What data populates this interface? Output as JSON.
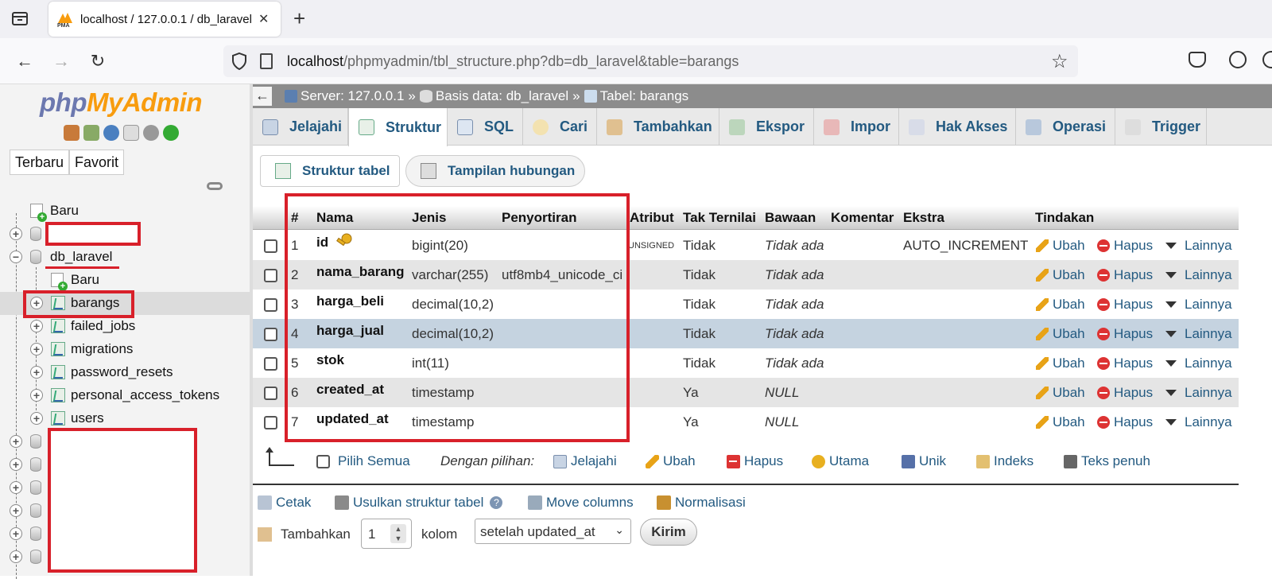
{
  "browser": {
    "tab_title": "localhost / 127.0.0.1 / db_laravel",
    "tab_close": "✕",
    "new_tab": "+",
    "url_host": "localhost",
    "url_path": "/phpmyadmin/tbl_structure.php?db=db_laravel&table=barangs"
  },
  "sidebar": {
    "logo_php": "php",
    "logo_myadmin": "MyAdmin",
    "btn_recent": "Terbaru",
    "btn_favorite": "Favorit",
    "tree": {
      "new_root": "Baru",
      "db_name": "db_laravel",
      "new_table": "Baru",
      "tables": [
        "barangs",
        "failed_jobs",
        "migrations",
        "password_resets",
        "personal_access_tokens",
        "users"
      ]
    }
  },
  "breadcrumb": {
    "server": "Server: 127.0.0.1",
    "database": "Basis data: db_laravel",
    "table": "Tabel: barangs",
    "separator": "»"
  },
  "tabs": [
    "Jelajahi",
    "Struktur",
    "SQL",
    "Cari",
    "Tambahkan",
    "Ekspor",
    "Impor",
    "Hak Akses",
    "Operasi",
    "Trigger"
  ],
  "subtabs": [
    "Struktur tabel",
    "Tampilan hubungan"
  ],
  "columns_header": [
    "#",
    "Nama",
    "Jenis",
    "Penyortiran",
    "Atribut",
    "Tak Ternilai",
    "Bawaan",
    "Komentar",
    "Ekstra",
    "Tindakan"
  ],
  "rows": [
    {
      "num": "1",
      "name": "id",
      "type": "bigint(20)",
      "collation": "",
      "attribute": "UNSIGNED",
      "null": "Tidak",
      "default": "Tidak ada",
      "extra": "AUTO_INCREMENT"
    },
    {
      "num": "2",
      "name": "nama_barang",
      "type": "varchar(255)",
      "collation": "utf8mb4_unicode_ci",
      "attribute": "",
      "null": "Tidak",
      "default": "Tidak ada",
      "extra": ""
    },
    {
      "num": "3",
      "name": "harga_beli",
      "type": "decimal(10,2)",
      "collation": "",
      "attribute": "",
      "null": "Tidak",
      "default": "Tidak ada",
      "extra": ""
    },
    {
      "num": "4",
      "name": "harga_jual",
      "type": "decimal(10,2)",
      "collation": "",
      "attribute": "",
      "null": "Tidak",
      "default": "Tidak ada",
      "extra": ""
    },
    {
      "num": "5",
      "name": "stok",
      "type": "int(11)",
      "collation": "",
      "attribute": "",
      "null": "Tidak",
      "default": "Tidak ada",
      "extra": ""
    },
    {
      "num": "6",
      "name": "created_at",
      "type": "timestamp",
      "collation": "",
      "attribute": "",
      "null": "Ya",
      "default": "NULL",
      "extra": ""
    },
    {
      "num": "7",
      "name": "updated_at",
      "type": "timestamp",
      "collation": "",
      "attribute": "",
      "null": "Ya",
      "default": "NULL",
      "extra": ""
    }
  ],
  "actions": {
    "edit": "Ubah",
    "drop": "Hapus",
    "more": "Lainnya"
  },
  "bulk": {
    "check_all": "Pilih Semua",
    "with_selected": "Dengan pilihan:",
    "items": [
      "Jelajahi",
      "Ubah",
      "Hapus",
      "Utama",
      "Unik",
      "Indeks",
      "Teks penuh"
    ]
  },
  "lower_links": [
    "Cetak",
    "Usulkan struktur tabel",
    "Move columns",
    "Normalisasi"
  ],
  "add_columns": {
    "label": "Tambahkan",
    "count": "1",
    "unit": "kolom",
    "position": "setelah updated_at",
    "submit": "Kirim"
  },
  "colors": {
    "link": "#235a81",
    "highlight_box": "#d8202a",
    "row_highlight": "#c5d3e0"
  }
}
